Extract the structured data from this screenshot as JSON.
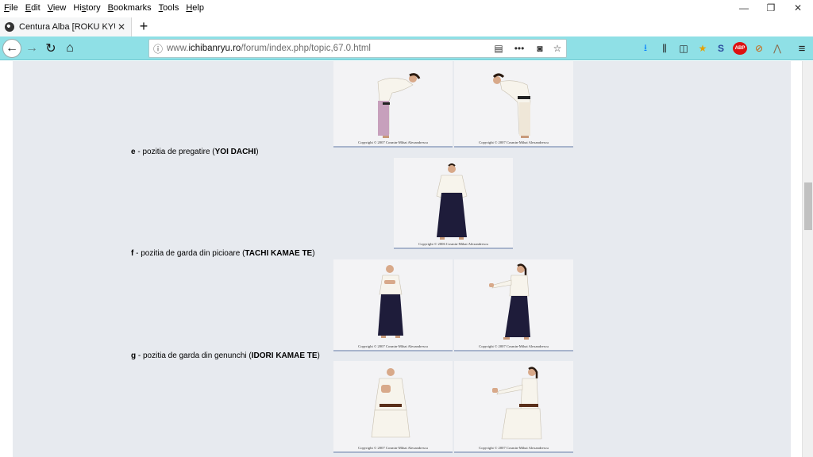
{
  "menu": [
    "File",
    "Edit",
    "View",
    "History",
    "Bookmarks",
    "Tools",
    "Help"
  ],
  "menu_underline": [
    "F",
    "E",
    "V",
    "s",
    "B",
    "T",
    "H"
  ],
  "window_controls": {
    "minimize": "—",
    "restore": "❐",
    "close": "✕"
  },
  "tab": {
    "title": "Centura Alba [ROKU KYU]",
    "close": "✕"
  },
  "newtab": "+",
  "nav": {
    "back": "←",
    "forward": "→",
    "reload": "↻",
    "home": "⌂"
  },
  "urlbar": {
    "host_prefix": "www.",
    "host": "ichibanryu.ro",
    "path": "/forum/index.php/topic,67.0.html"
  },
  "toolbar_icons": [
    "download-icon",
    "library-icon",
    "sidebar-icon",
    "star-addon-icon",
    "s-addon-icon",
    "adblock-icon",
    "noscript-icon",
    "misc-addon-icon",
    "menu-icon"
  ],
  "toolbar_glyphs": {
    "download": "⭳",
    "library": "⫼",
    "sidebar": "◫",
    "star": "★",
    "s": "S",
    "abp": "ABP",
    "noscript": "⊘",
    "misc": "⋀",
    "menu": "≡"
  },
  "captions": {
    "e": {
      "letter": "e",
      "text": " - pozitia de pregatire (",
      "term": "YOI DACHI",
      "close": ")"
    },
    "f": {
      "letter": "f",
      "text": " - pozitia de garda din picioare (",
      "term": "TACHI KAMAE TE",
      "close": ")"
    },
    "g": {
      "letter": "g",
      "text": " - pozitia de garda din genunchi (",
      "term": "IDORI KAMAE TE",
      "close": ")"
    }
  },
  "copyright": {
    "c2007": "Copyright © 2007 Cosmin-Mihai Alexandrescu",
    "c2006": "Copyright © 2006 Cosmin-Mihai Alexandrescu"
  },
  "colors": {
    "toolbar_bg": "#8fe0e6",
    "forum_bg": "#e7eaef",
    "hakama": "#1e1c3a",
    "gi": "#f7f4ec"
  }
}
